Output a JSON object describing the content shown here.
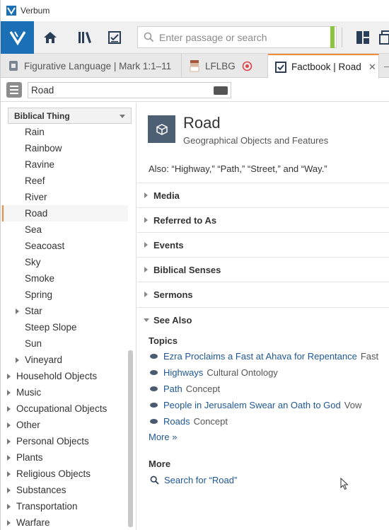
{
  "window": {
    "title": "Verbum"
  },
  "toolbar": {
    "search_placeholder": "Enter passage or search",
    "icons": [
      "home-icon",
      "library-icon",
      "docs-icon",
      "search-icon",
      "layout-icon",
      "windows-icon"
    ]
  },
  "tabs": [
    {
      "label": "Figurative Language | Mark 1:1–11",
      "icon": "figurative-language-icon"
    },
    {
      "label": "LFLBG",
      "icon": "book-icon"
    },
    {
      "label": "Factbook | Road",
      "icon": "factbook-icon",
      "active": true
    }
  ],
  "resource": {
    "reference_value": "Road"
  },
  "left": {
    "dropdown_value": "Biblical Thing",
    "tree": [
      {
        "label": "Rain",
        "level": 2
      },
      {
        "label": "Rainbow",
        "level": 2
      },
      {
        "label": "Ravine",
        "level": 2
      },
      {
        "label": "Reef",
        "level": 2
      },
      {
        "label": "River",
        "level": 2
      },
      {
        "label": "Road",
        "level": 2,
        "selected": true
      },
      {
        "label": "Sea",
        "level": 2
      },
      {
        "label": "Seacoast",
        "level": 2
      },
      {
        "label": "Sky",
        "level": 2
      },
      {
        "label": "Smoke",
        "level": 2
      },
      {
        "label": "Spring",
        "level": 2
      },
      {
        "label": "Star",
        "level": 2,
        "expandable": true
      },
      {
        "label": "Steep Slope",
        "level": 2
      },
      {
        "label": "Sun",
        "level": 2
      },
      {
        "label": "Vineyard",
        "level": 2,
        "expandable": true
      },
      {
        "label": "Household Objects",
        "level": 1,
        "expandable": true
      },
      {
        "label": "Music",
        "level": 1,
        "expandable": true
      },
      {
        "label": "Occupational Objects",
        "level": 1,
        "expandable": true
      },
      {
        "label": "Other",
        "level": 1,
        "expandable": true
      },
      {
        "label": "Personal Objects",
        "level": 1,
        "expandable": true
      },
      {
        "label": "Plants",
        "level": 1,
        "expandable": true
      },
      {
        "label": "Religious Objects",
        "level": 1,
        "expandable": true
      },
      {
        "label": "Substances",
        "level": 1,
        "expandable": true
      },
      {
        "label": "Transportation",
        "level": 1,
        "expandable": true
      },
      {
        "label": "Warfare",
        "level": 1,
        "expandable": true
      }
    ]
  },
  "article": {
    "title": "Road",
    "subtitle": "Geographical Objects and Features",
    "also": "Also: “Highway,” “Path,” “Street,” and “Way.”",
    "sections": [
      "Media",
      "Referred to As",
      "Events",
      "Biblical Senses",
      "Sermons",
      "See Also"
    ],
    "topics_heading": "Topics",
    "topics": [
      {
        "link": "Ezra Proclaims a Fast at Ahava for Repentance",
        "meta": "Fast"
      },
      {
        "link": "Highways",
        "meta": "Cultural Ontology"
      },
      {
        "link": "Path",
        "meta": "Concept"
      },
      {
        "link": "People in Jerusalem Swear an Oath to God",
        "meta": "Vow"
      },
      {
        "link": "Roads",
        "meta": "Concept"
      }
    ],
    "more_link": "More »",
    "more_heading": "More",
    "search_link": "Search for “Road”"
  },
  "colors": {
    "brand": "#1b6fb4",
    "accent": "#f08c3c",
    "link": "#1f5796",
    "status_green": "#8cc63f"
  }
}
